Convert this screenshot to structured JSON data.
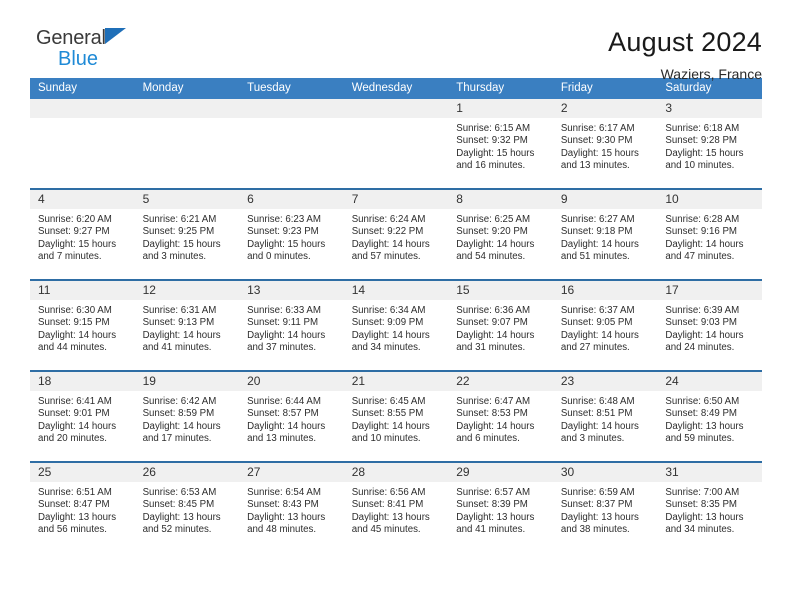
{
  "brand": {
    "name_top": "General",
    "name_bottom": "Blue",
    "flag_icon": "triangle-flag-icon",
    "color_dark": "#3a3a3a",
    "color_blue": "#1f8ad6"
  },
  "header": {
    "title": "August 2024",
    "location": "Waziers, France"
  },
  "theme": {
    "header_bar": "#3a7fc1",
    "row_divider": "#2e6da4",
    "daynum_band": "#f0f0f0"
  },
  "weekday_headers": [
    "Sunday",
    "Monday",
    "Tuesday",
    "Wednesday",
    "Thursday",
    "Friday",
    "Saturday"
  ],
  "weeks": [
    [
      {
        "day": "",
        "empty": true
      },
      {
        "day": "",
        "empty": true
      },
      {
        "day": "",
        "empty": true
      },
      {
        "day": "",
        "empty": true
      },
      {
        "day": "1",
        "sunrise": "Sunrise: 6:15 AM",
        "sunset": "Sunset: 9:32 PM",
        "daylight": "Daylight: 15 hours and 16 minutes."
      },
      {
        "day": "2",
        "sunrise": "Sunrise: 6:17 AM",
        "sunset": "Sunset: 9:30 PM",
        "daylight": "Daylight: 15 hours and 13 minutes."
      },
      {
        "day": "3",
        "sunrise": "Sunrise: 6:18 AM",
        "sunset": "Sunset: 9:28 PM",
        "daylight": "Daylight: 15 hours and 10 minutes."
      }
    ],
    [
      {
        "day": "4",
        "sunrise": "Sunrise: 6:20 AM",
        "sunset": "Sunset: 9:27 PM",
        "daylight": "Daylight: 15 hours and 7 minutes."
      },
      {
        "day": "5",
        "sunrise": "Sunrise: 6:21 AM",
        "sunset": "Sunset: 9:25 PM",
        "daylight": "Daylight: 15 hours and 3 minutes."
      },
      {
        "day": "6",
        "sunrise": "Sunrise: 6:23 AM",
        "sunset": "Sunset: 9:23 PM",
        "daylight": "Daylight: 15 hours and 0 minutes."
      },
      {
        "day": "7",
        "sunrise": "Sunrise: 6:24 AM",
        "sunset": "Sunset: 9:22 PM",
        "daylight": "Daylight: 14 hours and 57 minutes."
      },
      {
        "day": "8",
        "sunrise": "Sunrise: 6:25 AM",
        "sunset": "Sunset: 9:20 PM",
        "daylight": "Daylight: 14 hours and 54 minutes."
      },
      {
        "day": "9",
        "sunrise": "Sunrise: 6:27 AM",
        "sunset": "Sunset: 9:18 PM",
        "daylight": "Daylight: 14 hours and 51 minutes."
      },
      {
        "day": "10",
        "sunrise": "Sunrise: 6:28 AM",
        "sunset": "Sunset: 9:16 PM",
        "daylight": "Daylight: 14 hours and 47 minutes."
      }
    ],
    [
      {
        "day": "11",
        "sunrise": "Sunrise: 6:30 AM",
        "sunset": "Sunset: 9:15 PM",
        "daylight": "Daylight: 14 hours and 44 minutes."
      },
      {
        "day": "12",
        "sunrise": "Sunrise: 6:31 AM",
        "sunset": "Sunset: 9:13 PM",
        "daylight": "Daylight: 14 hours and 41 minutes."
      },
      {
        "day": "13",
        "sunrise": "Sunrise: 6:33 AM",
        "sunset": "Sunset: 9:11 PM",
        "daylight": "Daylight: 14 hours and 37 minutes."
      },
      {
        "day": "14",
        "sunrise": "Sunrise: 6:34 AM",
        "sunset": "Sunset: 9:09 PM",
        "daylight": "Daylight: 14 hours and 34 minutes."
      },
      {
        "day": "15",
        "sunrise": "Sunrise: 6:36 AM",
        "sunset": "Sunset: 9:07 PM",
        "daylight": "Daylight: 14 hours and 31 minutes."
      },
      {
        "day": "16",
        "sunrise": "Sunrise: 6:37 AM",
        "sunset": "Sunset: 9:05 PM",
        "daylight": "Daylight: 14 hours and 27 minutes."
      },
      {
        "day": "17",
        "sunrise": "Sunrise: 6:39 AM",
        "sunset": "Sunset: 9:03 PM",
        "daylight": "Daylight: 14 hours and 24 minutes."
      }
    ],
    [
      {
        "day": "18",
        "sunrise": "Sunrise: 6:41 AM",
        "sunset": "Sunset: 9:01 PM",
        "daylight": "Daylight: 14 hours and 20 minutes."
      },
      {
        "day": "19",
        "sunrise": "Sunrise: 6:42 AM",
        "sunset": "Sunset: 8:59 PM",
        "daylight": "Daylight: 14 hours and 17 minutes."
      },
      {
        "day": "20",
        "sunrise": "Sunrise: 6:44 AM",
        "sunset": "Sunset: 8:57 PM",
        "daylight": "Daylight: 14 hours and 13 minutes."
      },
      {
        "day": "21",
        "sunrise": "Sunrise: 6:45 AM",
        "sunset": "Sunset: 8:55 PM",
        "daylight": "Daylight: 14 hours and 10 minutes."
      },
      {
        "day": "22",
        "sunrise": "Sunrise: 6:47 AM",
        "sunset": "Sunset: 8:53 PM",
        "daylight": "Daylight: 14 hours and 6 minutes."
      },
      {
        "day": "23",
        "sunrise": "Sunrise: 6:48 AM",
        "sunset": "Sunset: 8:51 PM",
        "daylight": "Daylight: 14 hours and 3 minutes."
      },
      {
        "day": "24",
        "sunrise": "Sunrise: 6:50 AM",
        "sunset": "Sunset: 8:49 PM",
        "daylight": "Daylight: 13 hours and 59 minutes."
      }
    ],
    [
      {
        "day": "25",
        "sunrise": "Sunrise: 6:51 AM",
        "sunset": "Sunset: 8:47 PM",
        "daylight": "Daylight: 13 hours and 56 minutes."
      },
      {
        "day": "26",
        "sunrise": "Sunrise: 6:53 AM",
        "sunset": "Sunset: 8:45 PM",
        "daylight": "Daylight: 13 hours and 52 minutes."
      },
      {
        "day": "27",
        "sunrise": "Sunrise: 6:54 AM",
        "sunset": "Sunset: 8:43 PM",
        "daylight": "Daylight: 13 hours and 48 minutes."
      },
      {
        "day": "28",
        "sunrise": "Sunrise: 6:56 AM",
        "sunset": "Sunset: 8:41 PM",
        "daylight": "Daylight: 13 hours and 45 minutes."
      },
      {
        "day": "29",
        "sunrise": "Sunrise: 6:57 AM",
        "sunset": "Sunset: 8:39 PM",
        "daylight": "Daylight: 13 hours and 41 minutes."
      },
      {
        "day": "30",
        "sunrise": "Sunrise: 6:59 AM",
        "sunset": "Sunset: 8:37 PM",
        "daylight": "Daylight: 13 hours and 38 minutes."
      },
      {
        "day": "31",
        "sunrise": "Sunrise: 7:00 AM",
        "sunset": "Sunset: 8:35 PM",
        "daylight": "Daylight: 13 hours and 34 minutes."
      }
    ]
  ]
}
